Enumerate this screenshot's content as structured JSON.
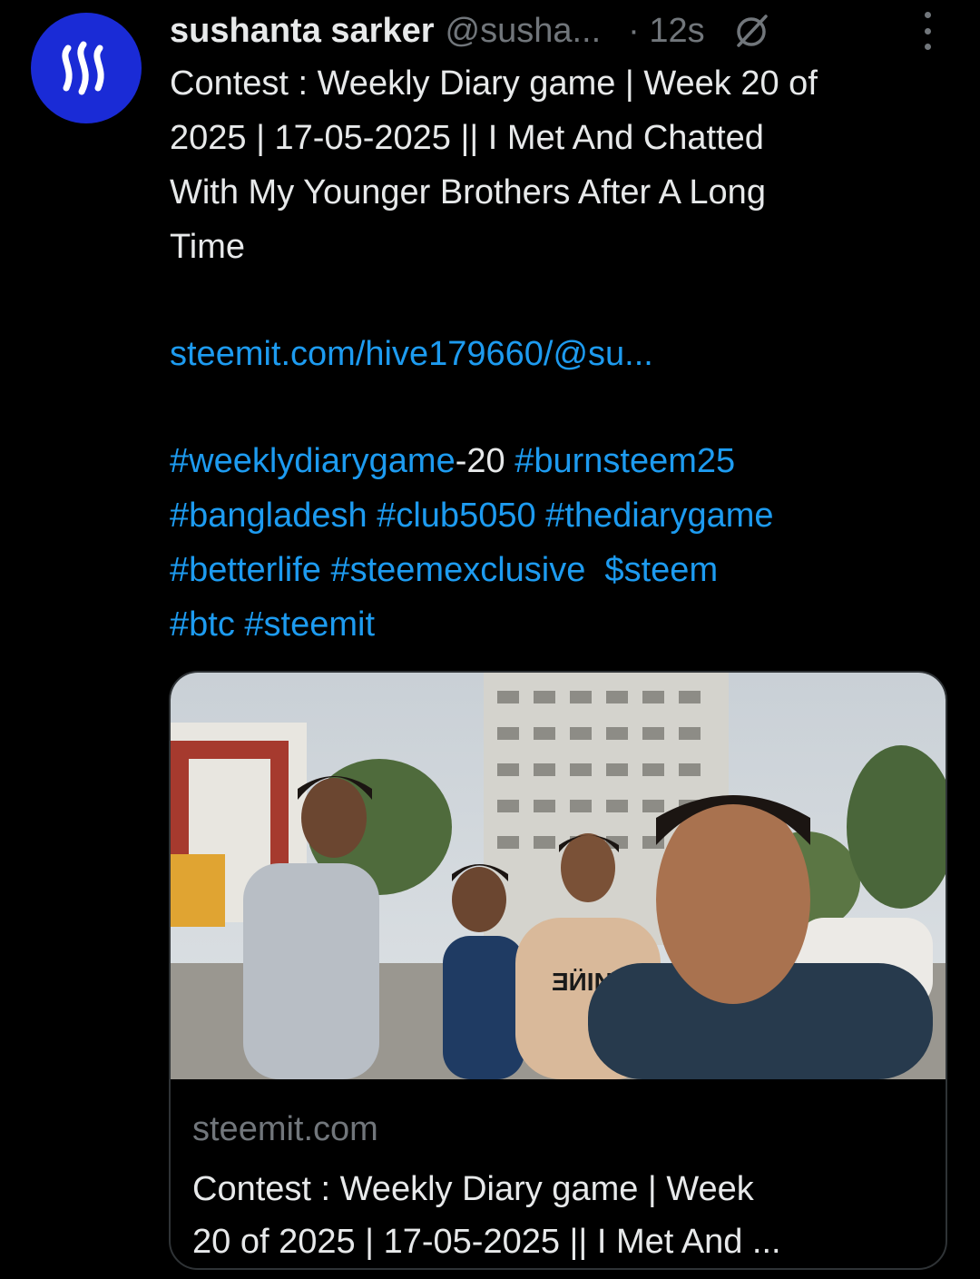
{
  "author": {
    "display_name": "sushanta sarker",
    "handle": "@susha...",
    "time": "· 12s",
    "avatar_icon": "steem-logo-icon",
    "avatar_color": "#1a2bd6"
  },
  "tweet": {
    "line1": "Contest : Weekly Diary game | Week 20 of",
    "line2": "2025 | 17-05-2025 || I Met And Chatted",
    "line3": "With My Younger Brothers After A Long",
    "line4": "Time",
    "url": "steemit.com/hive179660/@su...",
    "tags": {
      "t1": "#weeklydiarygame",
      "t1_suffix": "-20 ",
      "t2": "#burnsteem25",
      "t3": "#bangladesh",
      "t4": "#club5050",
      "t5": "#thediarygame",
      "t6": "#betterlife",
      "t7": "#steemexclusive",
      "t8": "$steem",
      "t9": "#btc",
      "t10": "#steemit"
    }
  },
  "card": {
    "domain": "steemit.com",
    "title_line1": "Contest : Weekly Diary game | Week",
    "title_line2": "20 of 2025 | 17-05-2025 || I Met And ..."
  },
  "colors": {
    "background": "#000000",
    "text": "#e7e9ea",
    "secondary": "#71767b",
    "link": "#1d9bf0",
    "border": "#2f3336"
  }
}
